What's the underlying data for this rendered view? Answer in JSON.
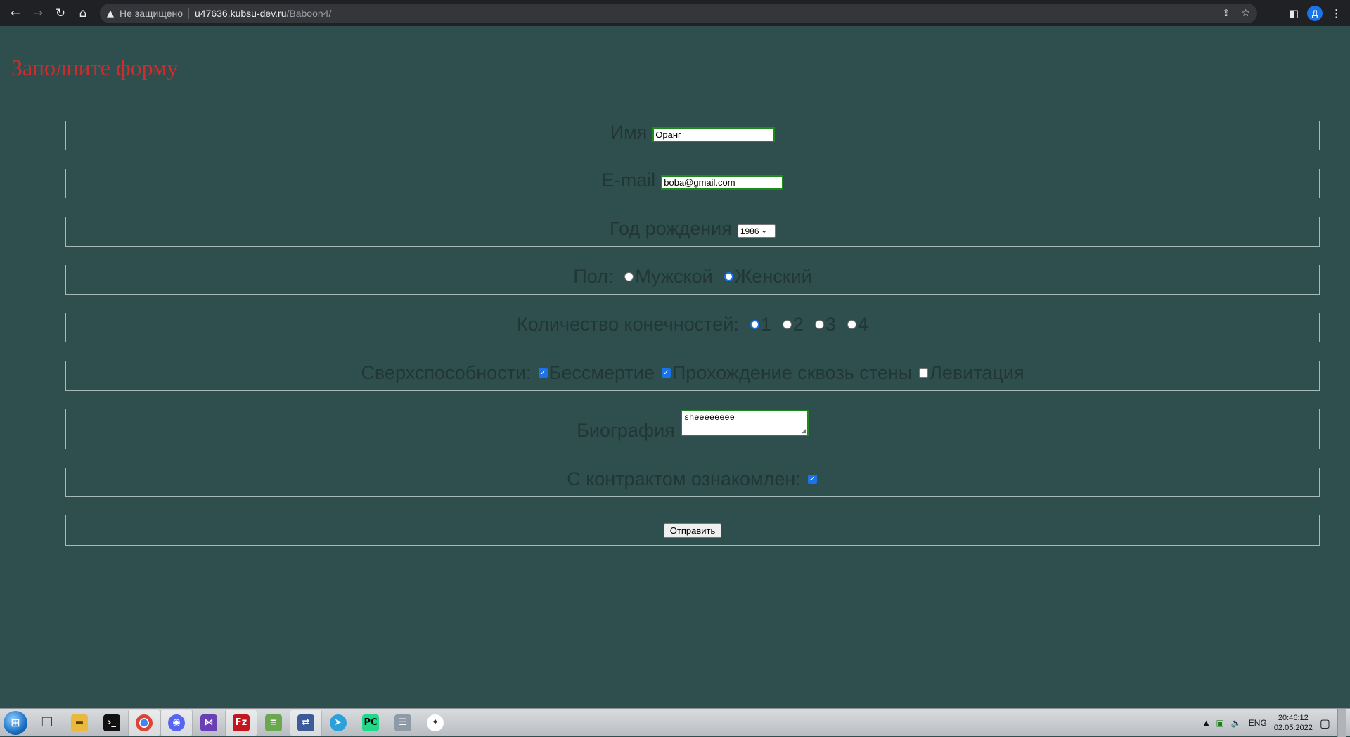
{
  "browser": {
    "security_label": "Не защищено",
    "url_host": "u47636.kubsu-dev.ru",
    "url_path": "/Baboon4/",
    "profile_initial": "Д"
  },
  "page": {
    "title": "Заполните форму"
  },
  "form": {
    "name": {
      "label": "Имя",
      "value": "Оранг"
    },
    "email": {
      "label": "E-mail",
      "value": "boba@gmail.com"
    },
    "birth_year": {
      "label": "Год рождения",
      "selected": "1986"
    },
    "gender": {
      "label": "Пол:",
      "options": [
        {
          "label": "Мужской",
          "checked": false
        },
        {
          "label": "Женский",
          "checked": true
        }
      ]
    },
    "limbs": {
      "label": "Количество конечностей:",
      "options": [
        {
          "label": "1",
          "checked": true
        },
        {
          "label": "2",
          "checked": false
        },
        {
          "label": "3",
          "checked": false
        },
        {
          "label": "4",
          "checked": false
        }
      ]
    },
    "abilities": {
      "label": "Сверхспособности:",
      "options": [
        {
          "label": "Бессмертие",
          "checked": true
        },
        {
          "label": "Прохождение сквозь стены",
          "checked": true
        },
        {
          "label": "Левитация",
          "checked": false
        }
      ]
    },
    "bio": {
      "label": "Биография",
      "value": "sheeeeeeee"
    },
    "contract": {
      "label": "С контрактом ознакомлен:",
      "checked": true
    },
    "submit_label": "Отправить"
  },
  "taskbar": {
    "language": "ENG",
    "time": "20:46:12",
    "date": "02.05.2022"
  }
}
